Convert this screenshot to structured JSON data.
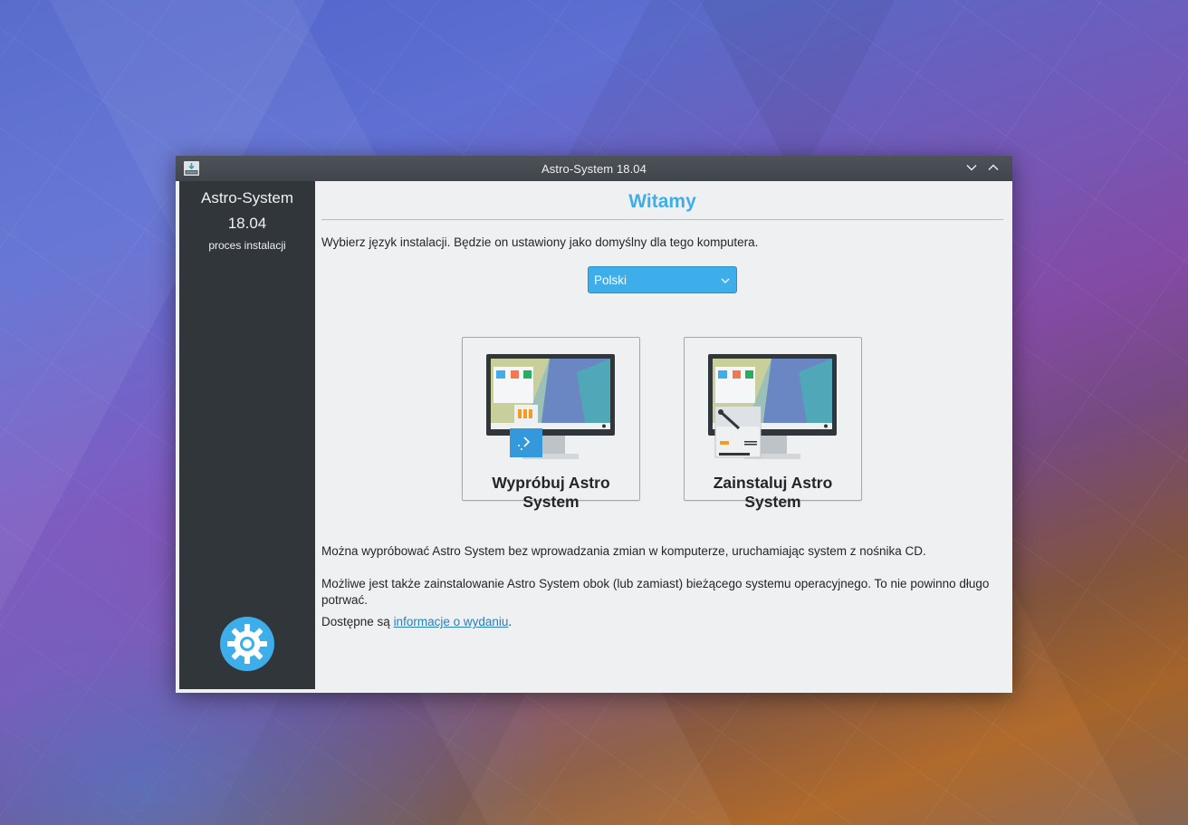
{
  "window": {
    "title": "Astro-System 18.04"
  },
  "sidebar": {
    "title": "Astro-System",
    "version": "18.04",
    "subtitle": "proces instalacji"
  },
  "main": {
    "heading": "Witamy",
    "prompt": "Wybierz język instalacji. Będzie on ustawiony jako domyślny dla tego komputera.",
    "language": {
      "selected": "Polski"
    },
    "choices": {
      "try_label": "Wypróbuj Astro System",
      "install_label": "Zainstaluj Astro System"
    },
    "paragraphs": {
      "try_info": "Można wypróbować Astro System bez wprowadzania zmian w komputerze, uruchamiając system z nośnika CD.",
      "install_info": "Możliwe jest także zainstalowanie Astro System obok (lub zamiast) bieżącego systemu operacyjnego. To nie powinno długo potrwać.",
      "release_prefix": "Dostępne są ",
      "release_link": "informacje o wydaniu",
      "release_suffix": "."
    }
  },
  "colors": {
    "accent": "#3daee9",
    "sidebar_bg": "#31363b",
    "window_bg": "#eff0f1",
    "link": "#2980b9"
  },
  "icons": {
    "app": "installer-download-icon",
    "minimize": "chevron-down-icon",
    "maximize": "chevron-up-icon",
    "dropdown": "chevron-down-icon",
    "logo": "kubuntu-gear-logo-icon"
  }
}
